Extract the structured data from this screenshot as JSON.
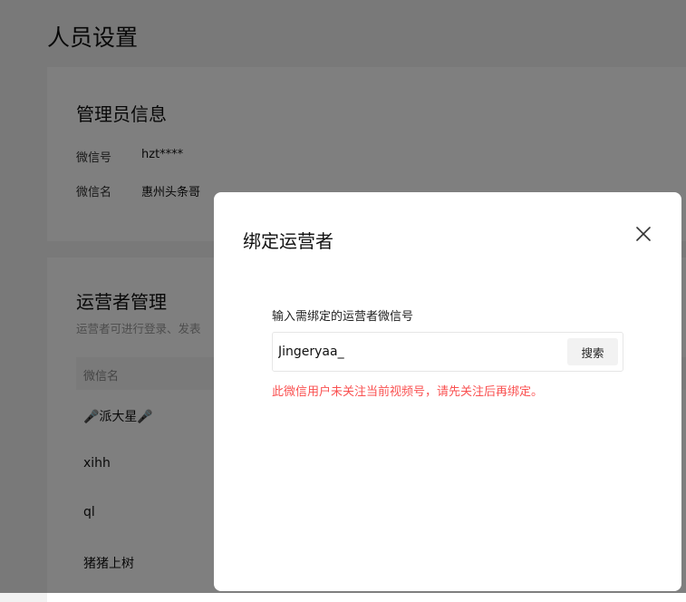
{
  "page": {
    "title": "人员设置"
  },
  "admin": {
    "title": "管理员信息",
    "fields": [
      {
        "label": "微信号",
        "value": "hzt****"
      },
      {
        "label": "微信名",
        "value": "惠州头条哥"
      }
    ]
  },
  "operators": {
    "title": "运营者管理",
    "description": "运营者可进行登录、发表",
    "column_header": "微信名",
    "rows": [
      {
        "name": "🎤派大星🎤"
      },
      {
        "name": "xihh"
      },
      {
        "name": "ql"
      },
      {
        "name": "猪猪上树"
      }
    ]
  },
  "modal": {
    "title": "绑定运营者",
    "input_label": "输入需绑定的运营者微信号",
    "input_value": "Jingeryaa_",
    "search_label": "搜索",
    "error_message": "此微信用户未关注当前视频号，请先关注后再绑定。"
  },
  "colors": {
    "error": "#fa5151",
    "overlay": "rgba(0,0,0,0.5)"
  }
}
